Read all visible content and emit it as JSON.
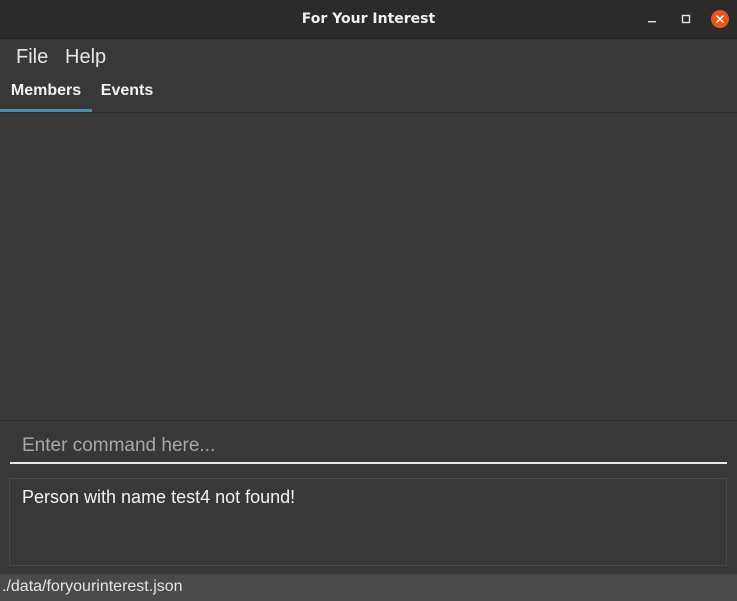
{
  "window": {
    "title": "For Your Interest"
  },
  "window_controls": {
    "minimize_icon": "minimize-icon",
    "maximize_icon": "maximize-icon",
    "close_icon": "close-icon",
    "close_color": "#e95420"
  },
  "menu": {
    "items": [
      {
        "label": "File"
      },
      {
        "label": "Help"
      }
    ]
  },
  "tabs": [
    {
      "label": "Members",
      "selected": true
    },
    {
      "label": "Events",
      "selected": false
    }
  ],
  "accent_color": "#4a8fa5",
  "command": {
    "placeholder": "Enter command here...",
    "value": ""
  },
  "result": {
    "text": "Person with name test4 not found!"
  },
  "status": {
    "path": "./data/foryourinterest.json"
  }
}
